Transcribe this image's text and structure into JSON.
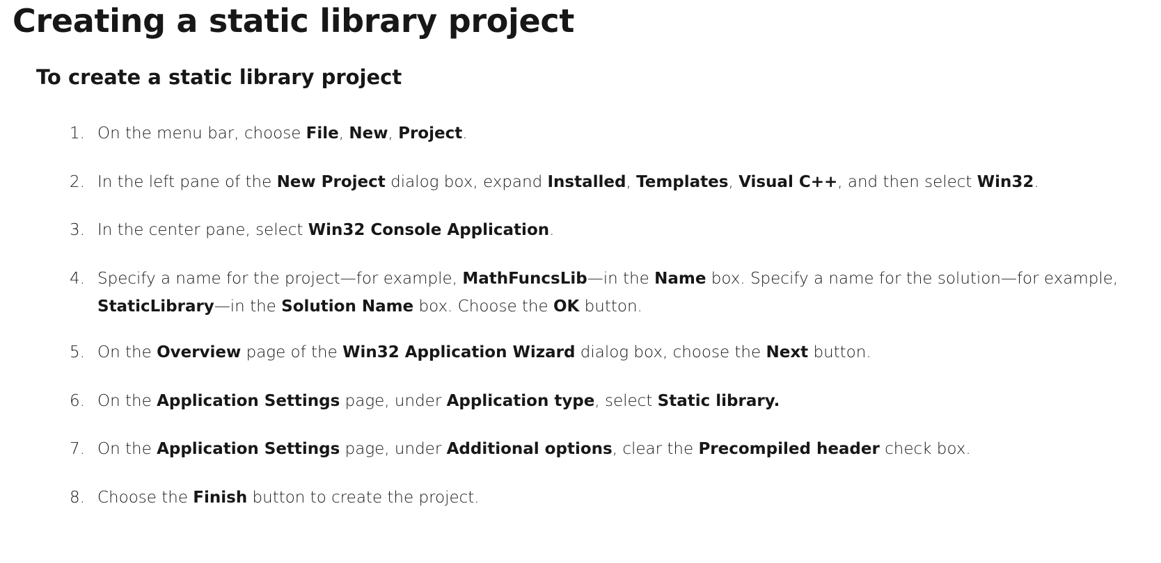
{
  "page_title": "Creating a static library project",
  "section_title": "To create a static library project",
  "steps": [
    {
      "num": "1.",
      "parts": [
        {
          "t": "On the menu bar, choose "
        },
        {
          "t": "File",
          "b": true
        },
        {
          "t": ", "
        },
        {
          "t": "New",
          "b": true
        },
        {
          "t": ", "
        },
        {
          "t": "Project",
          "b": true
        },
        {
          "t": "."
        }
      ]
    },
    {
      "num": "2.",
      "parts": [
        {
          "t": "In the left pane of the "
        },
        {
          "t": "New Project",
          "b": true
        },
        {
          "t": " dialog box, expand "
        },
        {
          "t": "Installed",
          "b": true
        },
        {
          "t": ", "
        },
        {
          "t": "Templates",
          "b": true
        },
        {
          "t": ", "
        },
        {
          "t": "Visual C++",
          "b": true
        },
        {
          "t": ", and then select "
        },
        {
          "t": "Win32",
          "b": true
        },
        {
          "t": "."
        }
      ]
    },
    {
      "num": "3.",
      "parts": [
        {
          "t": "In the center pane, select "
        },
        {
          "t": "Win32 Console Application",
          "b": true
        },
        {
          "t": "."
        }
      ]
    },
    {
      "num": "4.",
      "parts": [
        {
          "t": "Specify a name for the project—for example, "
        },
        {
          "t": "MathFuncsLib",
          "b": true
        },
        {
          "t": "—in the "
        },
        {
          "t": "Name",
          "b": true
        },
        {
          "t": " box. Specify a name for the solution—for example, "
        },
        {
          "t": "StaticLibrary",
          "b": true
        },
        {
          "t": "—in the "
        },
        {
          "t": "Solution Name",
          "b": true
        },
        {
          "t": " box. Choose the "
        },
        {
          "t": "OK",
          "b": true
        },
        {
          "t": " button."
        }
      ]
    },
    {
      "num": "5.",
      "parts": [
        {
          "t": "On the "
        },
        {
          "t": "Overview",
          "b": true
        },
        {
          "t": " page of the "
        },
        {
          "t": "Win32 Application Wizard",
          "b": true
        },
        {
          "t": " dialog box, choose the "
        },
        {
          "t": "Next",
          "b": true
        },
        {
          "t": " button."
        }
      ]
    },
    {
      "num": "6.",
      "parts": [
        {
          "t": "On the "
        },
        {
          "t": "Application Settings",
          "b": true
        },
        {
          "t": " page, under "
        },
        {
          "t": "Application type",
          "b": true
        },
        {
          "t": ", select "
        },
        {
          "t": "Static library.",
          "b": true
        }
      ]
    },
    {
      "num": "7.",
      "parts": [
        {
          "t": "On the "
        },
        {
          "t": "Application Settings",
          "b": true
        },
        {
          "t": " page, under "
        },
        {
          "t": "Additional options",
          "b": true
        },
        {
          "t": ", clear the "
        },
        {
          "t": "Precompiled header",
          "b": true
        },
        {
          "t": " check box."
        }
      ]
    },
    {
      "num": "8.",
      "parts": [
        {
          "t": "Choose the "
        },
        {
          "t": "Finish",
          "b": true
        },
        {
          "t": " button to create the project."
        }
      ]
    }
  ]
}
